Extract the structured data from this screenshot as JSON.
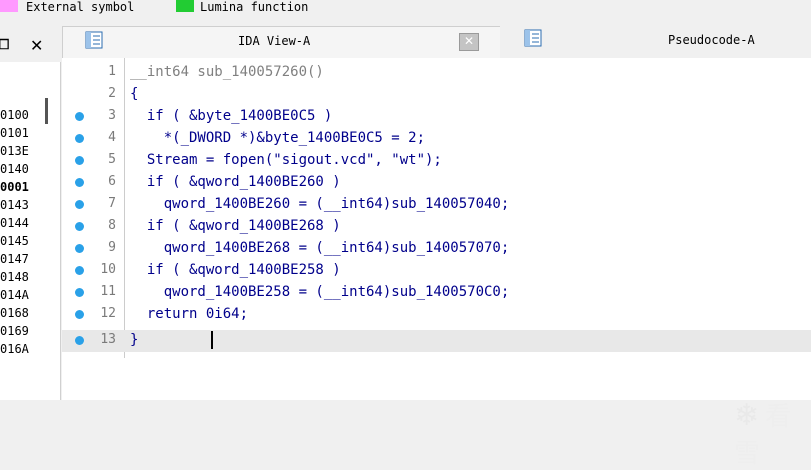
{
  "legend": [
    {
      "label": "External symbol",
      "color": "#ff99ff"
    },
    {
      "label": "Lumina function",
      "color": "#22cc33"
    }
  ],
  "left_panel": {
    "pin_icon": "pin-icon",
    "close_icon": "close-icon",
    "rows": [
      "0100",
      "0101",
      "013E",
      "0140",
      "0001",
      "0143",
      "0144",
      "0145",
      "0147",
      "0148",
      "014A",
      "0168",
      "0169",
      "016A"
    ]
  },
  "tabs": [
    {
      "label": "IDA View-A",
      "icon": "ida-view-icon"
    },
    {
      "label": "Pseudocode-A",
      "icon": "pseudocode-icon"
    }
  ],
  "code_lines": [
    {
      "num": "1",
      "text": "__int64 sub_140057260()"
    },
    {
      "num": "2",
      "text": "{"
    },
    {
      "num": "3",
      "text": "  if ( &byte_1400BE0C5 )"
    },
    {
      "num": "4",
      "text": "    *(_DWORD *)&byte_1400BE0C5 = 2;"
    },
    {
      "num": "5",
      "text": "  Stream = fopen(\"sigout.vcd\", \"wt\");"
    },
    {
      "num": "6",
      "text": "  if ( &qword_1400BE260 )"
    },
    {
      "num": "7",
      "text": "    qword_1400BE260 = (__int64)sub_140057040;"
    },
    {
      "num": "8",
      "text": "  if ( &qword_1400BE268 )"
    },
    {
      "num": "9",
      "text": "    qword_1400BE268 = (__int64)sub_140057070;"
    },
    {
      "num": "10",
      "text": "  if ( &qword_1400BE258 )"
    },
    {
      "num": "11",
      "text": "    qword_1400BE258 = (__int64)sub_1400570C0;"
    },
    {
      "num": "12",
      "text": "  return 0i64;"
    },
    {
      "num": "13",
      "text": "}"
    }
  ],
  "watermark": "看雪"
}
